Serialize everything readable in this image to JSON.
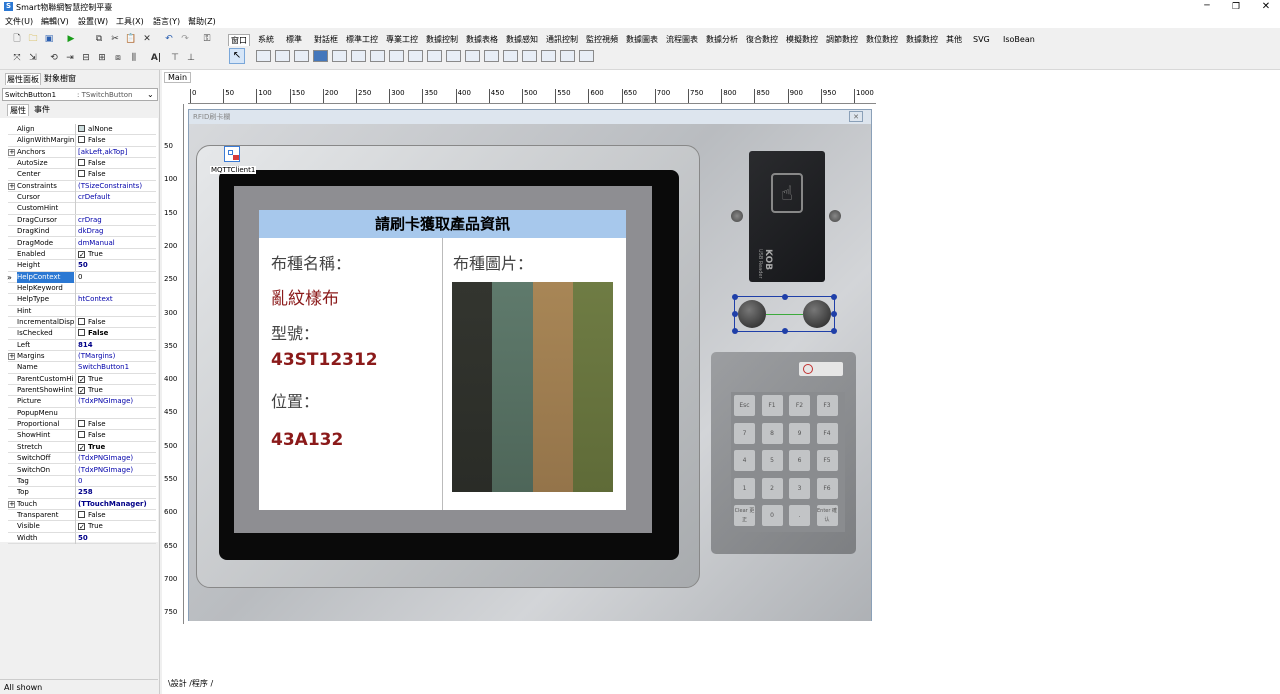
{
  "app": {
    "title": "Smart物聯網智慧控制平臺"
  },
  "menu": [
    "文件(U)",
    "編輯(V)",
    "設置(W)",
    "工具(X)",
    "語言(Y)",
    "幫助(Z)"
  ],
  "component_tabs": [
    "窗口",
    "系統",
    "標準",
    "對話框",
    "標準工控",
    "專業工控",
    "數據控制",
    "數據表格",
    "數據感知",
    "通訊控制",
    "監控視頻",
    "數據圖表",
    "流程圖表",
    "數據分析",
    "復合數控",
    "模擬數控",
    "調節數控",
    "數位數控",
    "數據數控",
    "其他",
    "SVG",
    "IsoBean"
  ],
  "panel_tabs": [
    "屬性面板",
    "對象樹窗"
  ],
  "component_selector": {
    "name": "SwitchButton1",
    "type": ": TSwitchButton"
  },
  "prop_tabs": [
    "屬性",
    "事件"
  ],
  "properties": [
    {
      "name": "Align",
      "value": "alNone",
      "icon": true
    },
    {
      "name": "AlignWithMargins",
      "value": "False",
      "cb": false
    },
    {
      "name": "Anchors",
      "value": "[akLeft,akTop]",
      "expand": true,
      "color": "#0000aa"
    },
    {
      "name": "AutoSize",
      "value": "False",
      "cb": false
    },
    {
      "name": "Center",
      "value": "False",
      "cb": false
    },
    {
      "name": "Constraints",
      "value": "(TSizeConstraints)",
      "expand": true,
      "color": "#0000aa"
    },
    {
      "name": "Cursor",
      "value": "crDefault",
      "color": "#0000aa"
    },
    {
      "name": "CustomHint",
      "value": ""
    },
    {
      "name": "DragCursor",
      "value": "crDrag",
      "color": "#0000aa"
    },
    {
      "name": "DragKind",
      "value": "dkDrag",
      "color": "#0000aa"
    },
    {
      "name": "DragMode",
      "value": "dmManual",
      "color": "#0000aa"
    },
    {
      "name": "Enabled",
      "value": "True",
      "cb": true
    },
    {
      "name": "Height",
      "value": "50",
      "bold": true,
      "color": "#000088"
    },
    {
      "name": "HelpContext",
      "value": "0",
      "selected": true
    },
    {
      "name": "HelpKeyword",
      "value": ""
    },
    {
      "name": "HelpType",
      "value": "htContext",
      "color": "#0000aa"
    },
    {
      "name": "Hint",
      "value": ""
    },
    {
      "name": "IncrementalDisplay",
      "value": "False",
      "cb": false
    },
    {
      "name": "IsChecked",
      "value": "False",
      "cb": false,
      "bold": true
    },
    {
      "name": "Left",
      "value": "814",
      "bold": true,
      "color": "#000088"
    },
    {
      "name": "Margins",
      "value": "(TMargins)",
      "expand": true,
      "color": "#0000aa"
    },
    {
      "name": "Name",
      "value": "SwitchButton1",
      "color": "#0000aa"
    },
    {
      "name": "ParentCustomHint",
      "value": "True",
      "cb": true
    },
    {
      "name": "ParentShowHint",
      "value": "True",
      "cb": true
    },
    {
      "name": "Picture",
      "value": "(TdxPNGImage)",
      "color": "#0000aa"
    },
    {
      "name": "PopupMenu",
      "value": ""
    },
    {
      "name": "Proportional",
      "value": "False",
      "cb": false
    },
    {
      "name": "ShowHint",
      "value": "False",
      "cb": false
    },
    {
      "name": "Stretch",
      "value": "True",
      "cb": true,
      "bold": true
    },
    {
      "name": "SwitchOff",
      "value": "(TdxPNGImage)",
      "color": "#0000aa"
    },
    {
      "name": "SwitchOn",
      "value": "(TdxPNGImage)",
      "color": "#0000aa"
    },
    {
      "name": "Tag",
      "value": "0",
      "color": "#0000aa"
    },
    {
      "name": "Top",
      "value": "258",
      "bold": true,
      "color": "#000088"
    },
    {
      "name": "Touch",
      "value": "(TTouchManager)",
      "expand": true,
      "bold": true,
      "color": "#000088"
    },
    {
      "name": "Transparent",
      "value": "False",
      "cb": false
    },
    {
      "name": "Visible",
      "value": "True",
      "cb": true
    },
    {
      "name": "Width",
      "value": "50",
      "bold": true,
      "color": "#000088"
    }
  ],
  "status": {
    "text": "All shown"
  },
  "design": {
    "tab": "Main",
    "form_caption": "RFID刷卡欄",
    "bottom_tabs": "\\設計 /程序 /",
    "mqtt_label": "MQTTClient1"
  },
  "ruler_h": [
    "0",
    "50",
    "100",
    "150",
    "200",
    "250",
    "300",
    "350",
    "400",
    "450",
    "500",
    "550",
    "600",
    "650",
    "700",
    "750",
    "800",
    "850",
    "900",
    "950",
    "1000"
  ],
  "ruler_v": [
    "50",
    "100",
    "150",
    "200",
    "250",
    "300",
    "350",
    "400",
    "450",
    "500",
    "550",
    "600",
    "650",
    "700",
    "750"
  ],
  "screen": {
    "header": "請刷卡獲取產品資訊",
    "cloth_name_label": "布種名稱：",
    "cloth_name": "亂紋樣布",
    "model_label": "型號：",
    "model": "43ST12312",
    "position_label": "位置：",
    "position": "43A132",
    "image_label": "布種圖片："
  },
  "reader": {
    "brand": "KOB",
    "sub": "USB Reader"
  },
  "keypad": {
    "keys": [
      "Esc",
      "F1",
      "F2",
      "F3",
      "7",
      "8",
      "9",
      "F4",
      "4",
      "5",
      "6",
      "F5",
      "1",
      "2",
      "3",
      "F6",
      "Clear 更正",
      "0",
      ".",
      "Enter 確认"
    ]
  },
  "colors": {
    "accent": "#2b78d3",
    "header_bg": "#a7c8ec",
    "value_red": "#8b1a1a"
  }
}
